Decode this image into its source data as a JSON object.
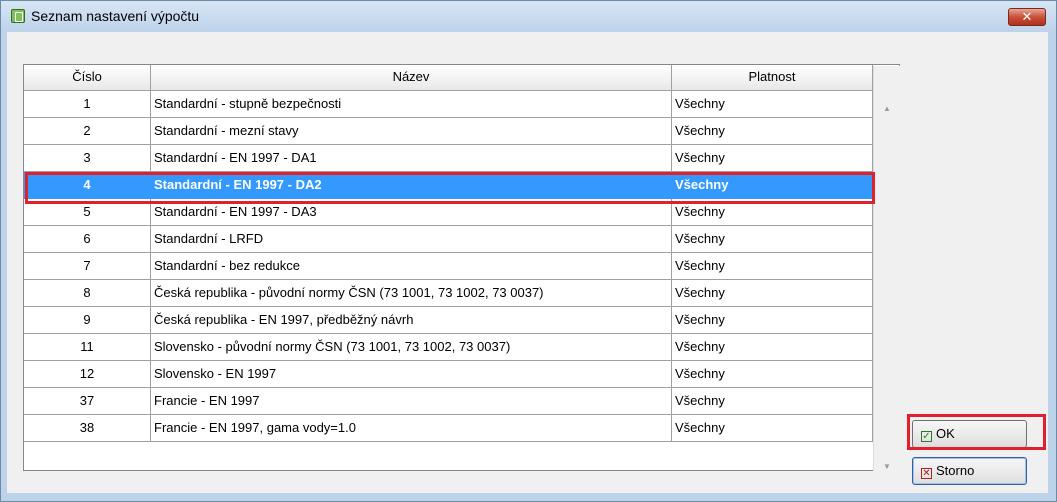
{
  "window": {
    "title": "Seznam nastavení výpočtu",
    "close_label": "✕"
  },
  "table": {
    "columns": [
      "Číslo",
      "Název",
      "Platnost"
    ],
    "rows": [
      {
        "num": "1",
        "name": "Standardní - stupně bezpečnosti",
        "validity": "Všechny"
      },
      {
        "num": "2",
        "name": "Standardní - mezní stavy",
        "validity": "Všechny"
      },
      {
        "num": "3",
        "name": "Standardní - EN 1997 - DA1",
        "validity": "Všechny"
      },
      {
        "num": "4",
        "name": "Standardní - EN 1997 - DA2",
        "validity": "Všechny",
        "selected": true
      },
      {
        "num": "5",
        "name": "Standardní - EN 1997 - DA3",
        "validity": "Všechny"
      },
      {
        "num": "6",
        "name": "Standardní - LRFD",
        "validity": "Všechny"
      },
      {
        "num": "7",
        "name": "Standardní - bez redukce",
        "validity": "Všechny"
      },
      {
        "num": "8",
        "name": "Česká republika - původní normy ČSN (73 1001, 73 1002, 73 0037)",
        "validity": "Všechny"
      },
      {
        "num": "9",
        "name": "Česká republika - EN 1997, předběžný návrh",
        "validity": "Všechny"
      },
      {
        "num": "11",
        "name": "Slovensko - původní normy ČSN (73 1001, 73 1002, 73 0037)",
        "validity": "Všechny"
      },
      {
        "num": "12",
        "name": "Slovensko - EN 1997",
        "validity": "Všechny"
      },
      {
        "num": "37",
        "name": "Francie - EN 1997",
        "validity": "Všechny"
      },
      {
        "num": "38",
        "name": "Francie - EN 1997, gama vody=1.0",
        "validity": "Všechny"
      }
    ]
  },
  "buttons": {
    "ok_label": "OK",
    "cancel_label": "Storno"
  },
  "colors": {
    "selection": "#3399ff",
    "highlight_outline": "#e0202a"
  }
}
